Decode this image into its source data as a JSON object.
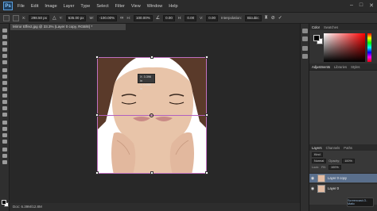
{
  "menubar": {
    "logo": "Ps",
    "items": [
      "File",
      "Edit",
      "Image",
      "Layer",
      "Type",
      "Select",
      "Filter",
      "View",
      "Window",
      "Help"
    ]
  },
  "options": {
    "x_label": "X:",
    "x_value": "298.50 px",
    "y_label": "Y:",
    "y_value": "635.00 px",
    "w_label": "W:",
    "w_value": "-100.00%",
    "h_label": "H:",
    "h_value": "100.00%",
    "angle_value": "0.00",
    "h_skew_label": "H:",
    "h_skew_value": "0.00",
    "v_skew_label": "V:",
    "v_skew_value": "0.00",
    "interp_label": "Interpolation:",
    "interp_value": "Bicubic"
  },
  "document": {
    "tab_title": "Mirror Effect.jpg @ 33.3% (Layer 0 copy, RGB/8) *",
    "status": "Doc: 6.39M/12.8M"
  },
  "tooltip": {
    "line1": "X: 3.396 in",
    "line2": "Y: 0.000 in"
  },
  "panels": {
    "color_tabs": [
      "Color",
      "Swatches"
    ],
    "adj_tabs": [
      "Adjustments",
      "Libraries",
      "Styles"
    ],
    "layers_tabs": [
      "Layers",
      "Channels",
      "Paths"
    ],
    "blend_mode": "Normal",
    "opacity_label": "Opacity:",
    "opacity_value": "100%",
    "lock_label": "Lock:",
    "fill_label": "Fill:",
    "fill_value": "100%",
    "kind_label": "Kind",
    "layers": [
      {
        "name": "Layer 0 copy",
        "selected": true
      },
      {
        "name": "Layer 0",
        "selected": false
      }
    ]
  },
  "watermark": "Screencast-O-Matic",
  "colors": {
    "accent": "#5a6f8c",
    "guide": "#b060c0"
  }
}
